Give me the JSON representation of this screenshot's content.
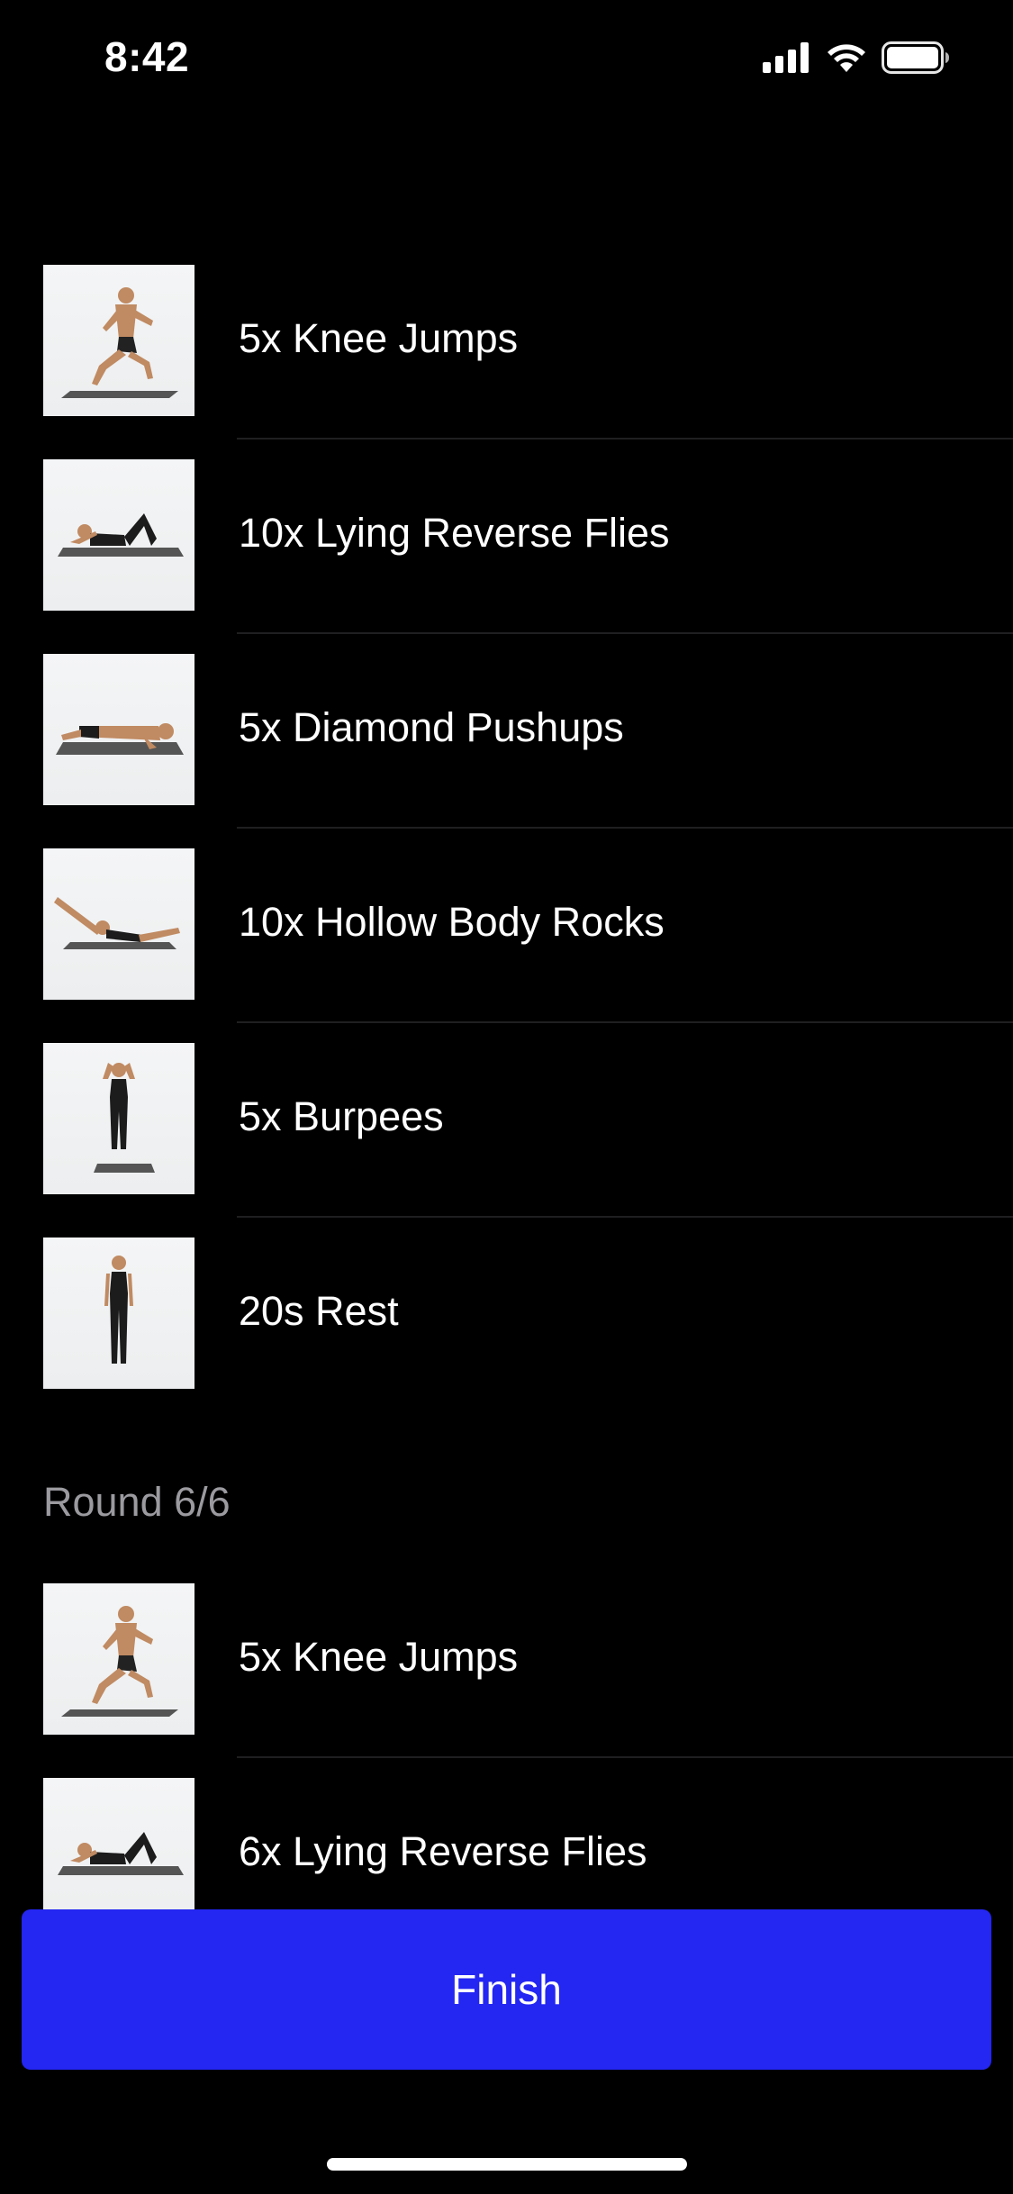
{
  "status_bar": {
    "time": "8:42",
    "icons": [
      "cellular-signal-icon",
      "wifi-icon",
      "battery-icon"
    ]
  },
  "exercises_round5": [
    {
      "label": "5x Knee Jumps",
      "thumb": "knee-jumps-thumbnail"
    },
    {
      "label": "10x Lying Reverse Flies",
      "thumb": "lying-reverse-flies-thumbnail"
    },
    {
      "label": "5x Diamond Pushups",
      "thumb": "diamond-pushups-thumbnail"
    },
    {
      "label": "10x Hollow Body Rocks",
      "thumb": "hollow-body-rocks-thumbnail"
    },
    {
      "label": "5x Burpees",
      "thumb": "burpees-thumbnail"
    },
    {
      "label": "20s Rest",
      "thumb": "rest-thumbnail"
    }
  ],
  "round_header": "Round 6/6",
  "exercises_round6": [
    {
      "label": "5x Knee Jumps",
      "thumb": "knee-jumps-thumbnail"
    },
    {
      "label": "6x Lying Reverse Flies",
      "thumb": "lying-reverse-flies-thumbnail"
    }
  ],
  "finish_button": {
    "label": "Finish",
    "color": "#2426F2"
  },
  "colors": {
    "background": "#000000",
    "text": "#FFFFFF",
    "secondary_text": "#9A9A9F",
    "divider": "#1F1F21"
  }
}
